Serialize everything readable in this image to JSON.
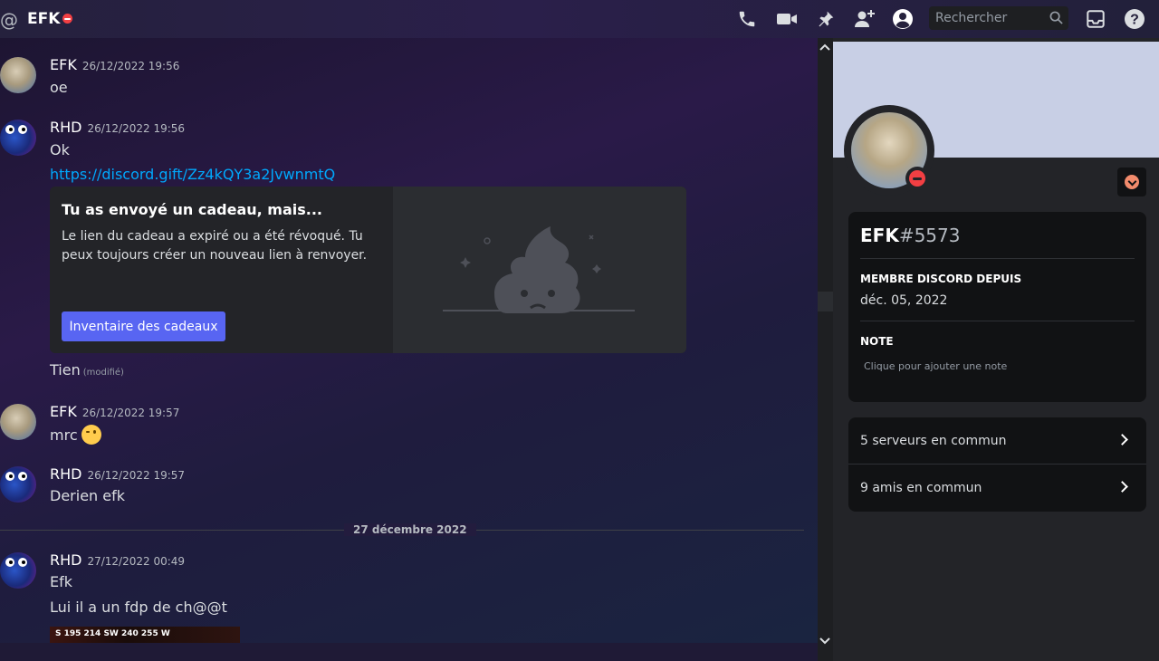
{
  "header": {
    "title": "EFK",
    "search_placeholder": "Rechercher"
  },
  "messages": [
    {
      "author": "EFK",
      "timestamp": "26/12/2022 19:56",
      "lines": [
        "oe"
      ]
    },
    {
      "author": "RHD",
      "timestamp": "26/12/2022 19:56",
      "lines": [
        "Ok"
      ],
      "link": "https://discord.gift/Zz4kQY3a2JvwnmtQ"
    },
    {
      "author": "EFK",
      "timestamp": "26/12/2022 19:57",
      "lines": [
        "mrc"
      ]
    },
    {
      "author": "RHD",
      "timestamp": "26/12/2022 19:57",
      "lines": [
        "Derien efk"
      ]
    },
    {
      "author": "RHD",
      "timestamp": "27/12/2022 00:49",
      "lines": [
        "Efk",
        "Lui il a un fdp de ch@@t"
      ]
    }
  ],
  "gift_embed": {
    "title": "Tu as envoyé un cadeau, mais...",
    "description": "Le lien du cadeau a expiré ou a été révoqué. Tu peux toujours créer un nouveau lien à renvoyer.",
    "button": "Inventaire des cadeaux"
  },
  "after_gift": {
    "text": "Tien",
    "edited": "(modifié)"
  },
  "date_divider": "27 décembre 2022",
  "image_strip_text": "S 195 214 SW 240 255 W",
  "profile": {
    "username": "EFK",
    "discriminator": "#5573",
    "member_since_label": "MEMBRE DISCORD DEPUIS",
    "member_since_value": "déc. 05, 2022",
    "note_label": "NOTE",
    "note_placeholder": "Clique pour ajouter une note",
    "mutual_servers": "5 serveurs en commun",
    "mutual_friends": "9 amis en commun"
  },
  "colors": {
    "accent": "#5865f2",
    "dnd": "#f23f43",
    "link": "#00a8fc",
    "banner": "#c8cfe5"
  },
  "icons": [
    "at-icon",
    "phone-call-icon",
    "video-call-icon",
    "pin-icon",
    "add-friend-icon",
    "user-profile-icon",
    "search-icon",
    "inbox-icon",
    "help-icon"
  ]
}
